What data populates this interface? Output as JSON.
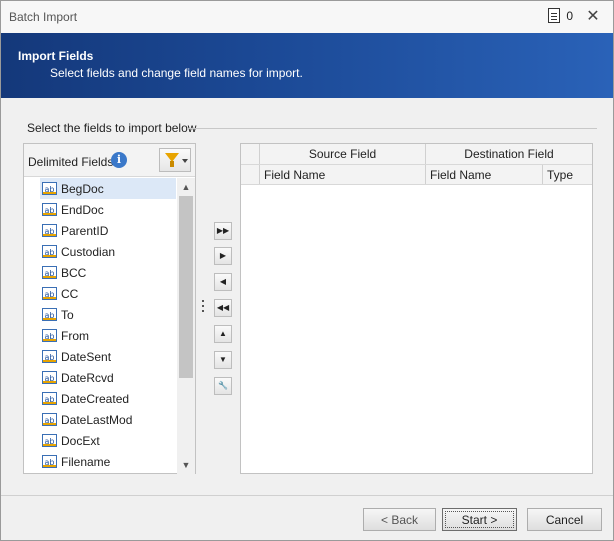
{
  "window": {
    "title": "Batch Import",
    "doc_count": "0",
    "close_glyph": "✕"
  },
  "header": {
    "title": "Import Fields",
    "subtitle": "Select fields and change field names for import."
  },
  "group_label": "Select the fields to import below",
  "left_panel": {
    "label": "Delimited Fields",
    "info_glyph": "i",
    "fields": [
      "BegDoc",
      "EndDoc",
      "ParentID",
      "Custodian",
      "BCC",
      "CC",
      "To",
      "From",
      "DateSent",
      "DateRcvd",
      "DateCreated",
      "DateLastMod",
      "DocExt",
      "Filename"
    ],
    "selected_index": 0,
    "field_icon_text": "ab"
  },
  "mid_buttons": [
    {
      "name": "add-all-button",
      "glyph": "▶▶"
    },
    {
      "name": "add-button",
      "glyph": "▶"
    },
    {
      "name": "remove-button",
      "glyph": "◀"
    },
    {
      "name": "remove-all-button",
      "glyph": "◀◀"
    },
    {
      "name": "move-up-button",
      "glyph": "▲"
    },
    {
      "name": "move-down-button",
      "glyph": "▼"
    },
    {
      "name": "edit-field-button",
      "glyph": "🔧"
    }
  ],
  "grid": {
    "group_headers": [
      "Source Field",
      "Destination Field"
    ],
    "columns": [
      "Field Name",
      "Field Name",
      "Type"
    ]
  },
  "footer": {
    "back": "< Back",
    "start": "Start >",
    "cancel": "Cancel"
  },
  "colors": {
    "header_dark": "#14387a",
    "header_light": "#2a62b8",
    "selection": "#dce8f7"
  }
}
